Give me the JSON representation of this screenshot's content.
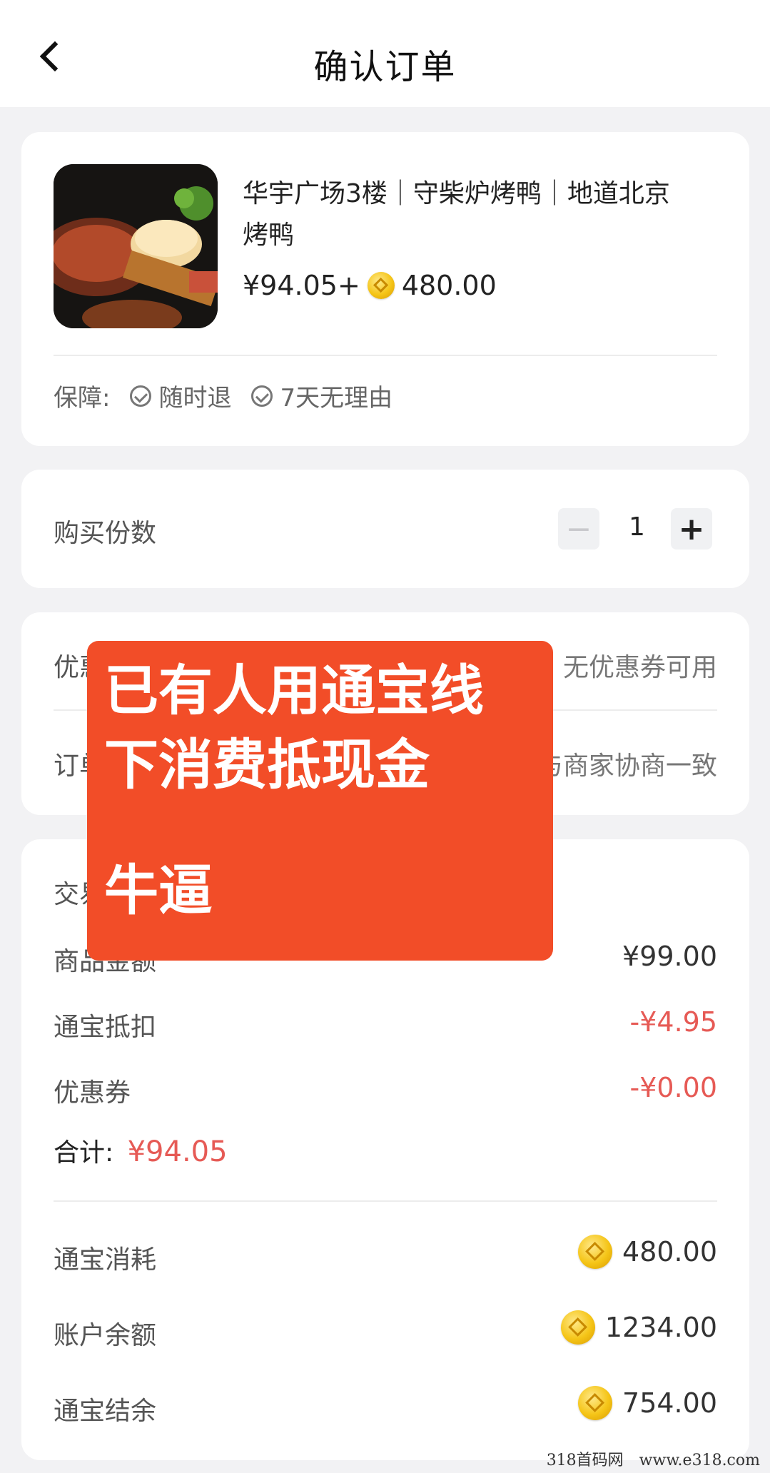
{
  "header": {
    "title": "确认订单"
  },
  "product": {
    "name": "华宇广场3楼｜守柴炉烤鸭｜地道北京烤鸭",
    "price": "¥94.05+",
    "coin_amount": "480.00",
    "guarantee_label": "保障:",
    "guarantees": [
      "随时退",
      "7天无理由"
    ]
  },
  "quantity": {
    "label": "购买份数",
    "value": "1",
    "minus": "−",
    "plus": "+"
  },
  "options": {
    "coupon_label": "优惠券",
    "coupon_value": "无优惠券可用",
    "remark_label": "订单备注",
    "remark_value": "请先与商家协商一致"
  },
  "details": {
    "title": "交易明细",
    "rows": [
      {
        "label": "商品金额",
        "value": "¥99.00"
      },
      {
        "label": "通宝抵扣",
        "value": "-¥4.95"
      },
      {
        "label": "优惠券",
        "value": "-¥0.00"
      }
    ],
    "total_label": "合计:",
    "total_value": "¥94.05",
    "coin_rows": [
      {
        "label": "通宝消耗",
        "value": "480.00"
      },
      {
        "label": "账户余额",
        "value": "1234.00"
      },
      {
        "label": "通宝结余",
        "value": "754.00"
      }
    ]
  },
  "overlay": {
    "line1": "已有人用通宝线",
    "line2": "下消费抵现金",
    "line3": "牛逼"
  },
  "watermark": "318首码网　www.e318.com",
  "colors": {
    "accent_red": "#e65a55",
    "overlay_bg": "#f24d28",
    "coin_gold": "#f5c518"
  }
}
